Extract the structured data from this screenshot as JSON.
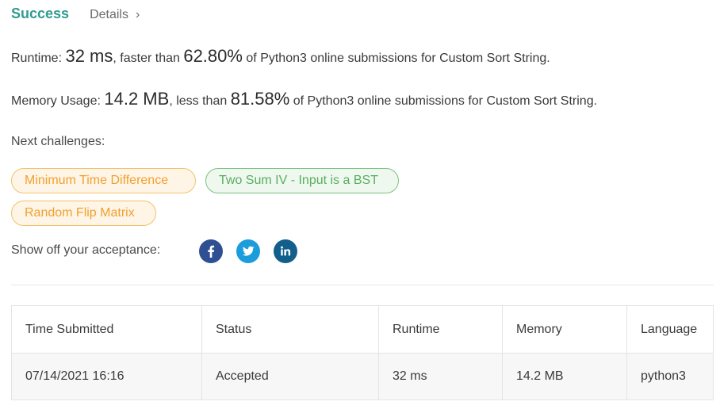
{
  "header": {
    "status": "Success",
    "details_label": "Details",
    "chevron": "›"
  },
  "runtime": {
    "label": "Runtime: ",
    "value": "32 ms",
    "mid": ", faster than ",
    "percent": "62.80%",
    "tail": " of Python3 online submissions for Custom Sort String."
  },
  "memory": {
    "label": "Memory Usage: ",
    "value": "14.2 MB",
    "mid": ", less than ",
    "percent": "81.58%",
    "tail": " of Python3 online submissions for Custom Sort String."
  },
  "next_challenges": {
    "label": "Next challenges:",
    "items": [
      {
        "title": "Minimum Time Difference",
        "difficulty": "medium"
      },
      {
        "title": "Two Sum IV - Input is a BST",
        "difficulty": "easy"
      },
      {
        "title": "Random Flip Matrix",
        "difficulty": "medium"
      }
    ]
  },
  "share": {
    "label": "Show off your acceptance:",
    "icons": [
      "facebook-icon",
      "twitter-icon",
      "linkedin-icon"
    ]
  },
  "colors": {
    "accent": "#2f9c8f",
    "medium": "#f0a030",
    "easy": "#5aae60",
    "facebook": "#2f4f93",
    "twitter": "#1c9ddb",
    "linkedin": "#125f8c"
  },
  "table": {
    "headers": [
      "Time Submitted",
      "Status",
      "Runtime",
      "Memory",
      "Language"
    ],
    "rows": [
      [
        "07/14/2021 16:16",
        "Accepted",
        "32 ms",
        "14.2 MB",
        "python3"
      ]
    ]
  }
}
